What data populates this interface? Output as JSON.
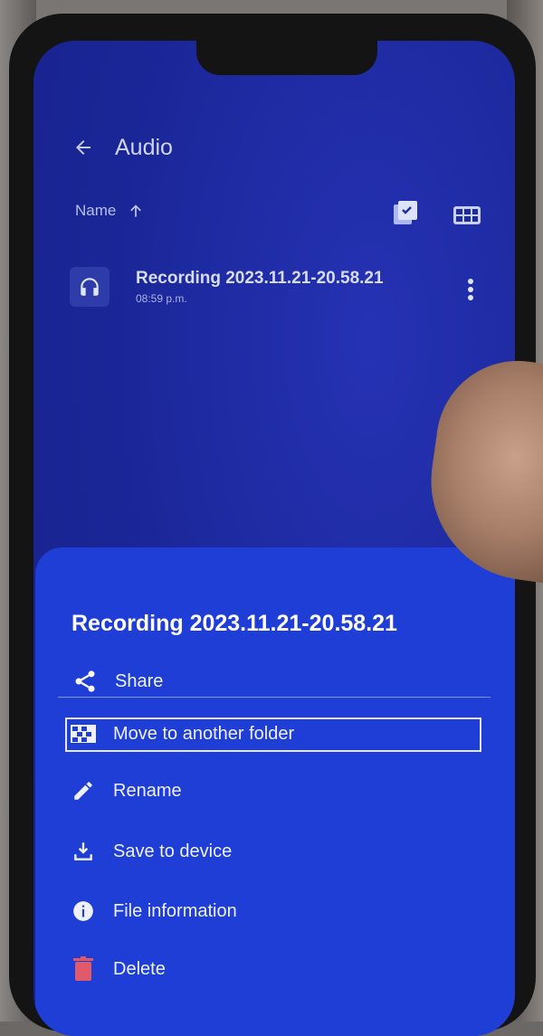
{
  "app": {
    "title": "Audio",
    "sort_label": "Name"
  },
  "file": {
    "name": "Recording 2023.11.21-20.58.21",
    "time": "08:59 p.m."
  },
  "sheet": {
    "title": "Recording 2023.11.21-20.58.21",
    "items": [
      {
        "label": "Share",
        "icon": "share-icon"
      },
      {
        "label": "Move to another folder",
        "icon": "move-folder-icon"
      },
      {
        "label": "Rename",
        "icon": "pencil-icon"
      },
      {
        "label": "Save to device",
        "icon": "download-icon"
      },
      {
        "label": "File information",
        "icon": "info-icon"
      },
      {
        "label": "Delete",
        "icon": "trash-icon"
      }
    ]
  },
  "colors": {
    "screen_bg": "#1d2aa0",
    "sheet_bg": "#1e3ed6",
    "delete_red": "#e05a6a"
  }
}
